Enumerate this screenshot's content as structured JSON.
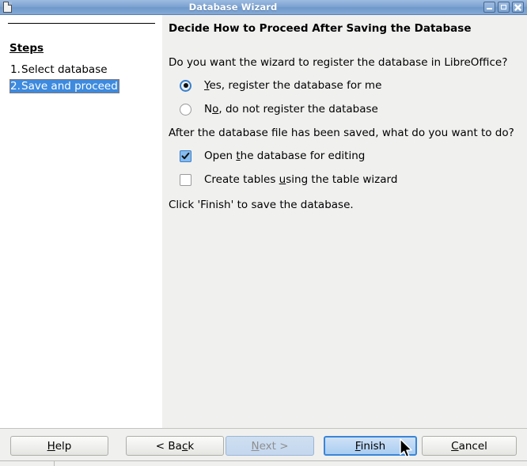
{
  "window": {
    "title": "Database Wizard",
    "icon": "document-icon",
    "controls": [
      {
        "name": "minimize-button",
        "glyph": "minimize-icon"
      },
      {
        "name": "maximize-button",
        "glyph": "maximize-icon"
      },
      {
        "name": "close-button",
        "glyph": "close-icon"
      }
    ]
  },
  "sidebar": {
    "heading": "Steps",
    "steps": [
      {
        "number": "1.",
        "label": "Select database",
        "selected": false
      },
      {
        "number": "2.",
        "label": "Save and proceed",
        "selected": true
      }
    ]
  },
  "content": {
    "title": "Decide How to Proceed After Saving the Database",
    "question_register": "Do you want the wizard to register the database in LibreOffice?",
    "radios": [
      {
        "name": "register-yes-radio",
        "label_before": "",
        "mnemonic": "Y",
        "label_after": "es, register the database for me",
        "checked": true
      },
      {
        "name": "register-no-radio",
        "label_before": "N",
        "mnemonic": "o",
        "label_after": ", do not register the database",
        "checked": false
      }
    ],
    "question_after_save": "After the database file has been saved, what do you want to do?",
    "checkboxes": [
      {
        "name": "open-database-checkbox",
        "label_before": "Open ",
        "mnemonic": "t",
        "label_after": "he database for editing",
        "checked": true
      },
      {
        "name": "create-tables-checkbox",
        "label_before": "Create tables ",
        "mnemonic": "u",
        "label_after": "sing the table wizard",
        "checked": false
      }
    ],
    "final_note": "Click 'Finish' to save the database."
  },
  "buttons": [
    {
      "name": "help-button",
      "before": "",
      "mnemonic": "H",
      "after": "elp",
      "state": "normal"
    },
    {
      "name": "back-button",
      "before": "< Ba",
      "mnemonic": "c",
      "after": "k",
      "state": "normal"
    },
    {
      "name": "next-button",
      "before": "",
      "mnemonic": "N",
      "after": "ext >",
      "state": "disabled"
    },
    {
      "name": "finish-button",
      "before": "",
      "mnemonic": "F",
      "after": "inish",
      "state": "default"
    },
    {
      "name": "cancel-button",
      "before": "",
      "mnemonic": "C",
      "after": "ancel",
      "state": "normal"
    }
  ],
  "colors": {
    "titlebar_blue": "#7ba2d0",
    "selection_blue": "#3d8ade",
    "focus_outline": "#b96a2a",
    "accent_blue": "#3a85d8",
    "checkbox_fill": "#86bbee",
    "dialog_bg": "#f0f0ef",
    "sidebar_bg": "#ffffff",
    "disabled_text": "#8e8e8e"
  }
}
